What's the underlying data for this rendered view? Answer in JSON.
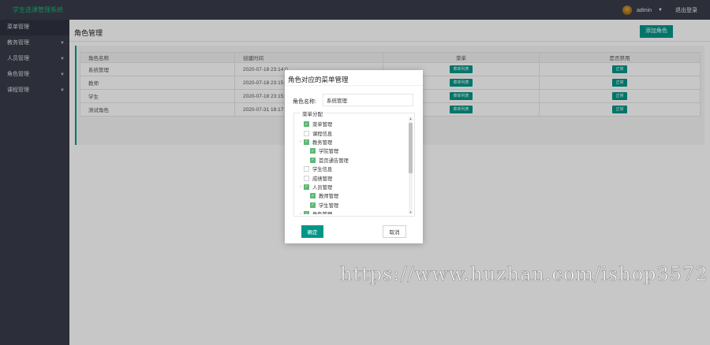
{
  "app": {
    "title": "学生选课管理系统"
  },
  "header": {
    "username": "admin",
    "logout_label": "退出登录"
  },
  "sidebar": {
    "items": [
      {
        "label": "菜单管理",
        "expandable": false
      },
      {
        "label": "教务管理",
        "expandable": true
      },
      {
        "label": "人员管理",
        "expandable": true
      },
      {
        "label": "角色管理",
        "expandable": true
      },
      {
        "label": "课程管理",
        "expandable": true
      }
    ]
  },
  "page": {
    "title": "角色管理",
    "add_button_label": "添加角色"
  },
  "table": {
    "columns": [
      "角色名称",
      "创建时间",
      "菜单",
      "是否禁用"
    ],
    "rows": [
      {
        "name": "系统管理",
        "created": "2020-07-18 23:14:0",
        "menu_btn": "菜单列表",
        "status_btn": "正常"
      },
      {
        "name": "教师",
        "created": "2020-07-18 23:15:0",
        "menu_btn": "菜单列表",
        "status_btn": "正常"
      },
      {
        "name": "学生",
        "created": "2020-07-18 23:15:0",
        "menu_btn": "菜单列表",
        "status_btn": "正常"
      },
      {
        "name": "测试角色",
        "created": "2020-07-31 18:17:5",
        "menu_btn": "菜单列表",
        "status_btn": "正常"
      }
    ]
  },
  "dialog": {
    "title": "角色对应的菜单管理",
    "role_label": "角色名称:",
    "role_value": "系统管理",
    "fieldset_legend": "菜单分配",
    "tree": [
      {
        "label": "菜单管理",
        "checked": true,
        "level": 0,
        "toggle": false
      },
      {
        "label": "课程信息",
        "checked": false,
        "level": 0,
        "toggle": false
      },
      {
        "label": "教务管理",
        "checked": true,
        "level": 0,
        "toggle": true
      },
      {
        "label": "学院管理",
        "checked": true,
        "level": 1,
        "toggle": false
      },
      {
        "label": "首页通告管理",
        "checked": true,
        "level": 1,
        "toggle": false
      },
      {
        "label": "学生信息",
        "checked": false,
        "level": 0,
        "toggle": false
      },
      {
        "label": "成绩管理",
        "checked": false,
        "level": 0,
        "toggle": false
      },
      {
        "label": "人员管理",
        "checked": true,
        "level": 0,
        "toggle": true
      },
      {
        "label": "教师管理",
        "checked": true,
        "level": 1,
        "toggle": false
      },
      {
        "label": "学生管理",
        "checked": true,
        "level": 1,
        "toggle": false
      },
      {
        "label": "角色管理",
        "checked": true,
        "level": 0,
        "toggle": true
      }
    ],
    "ok_label": "确定",
    "cancel_label": "取消"
  },
  "watermark": "https://www.huzhan.com/ishop3572",
  "colors": {
    "primary": "#009688",
    "checkbox": "#5fb878",
    "dark": "#393d49"
  }
}
